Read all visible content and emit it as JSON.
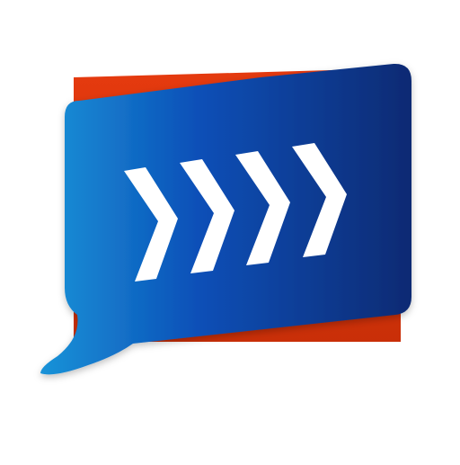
{
  "icon": {
    "name": "forward-chat-app-icon",
    "description_shapes": [
      "orange-card",
      "blue-speech-bubble",
      "chevron-arrows"
    ],
    "chevron_count": 4,
    "colors": {
      "background": "#ffffff",
      "card_orange": "#e53a0f",
      "card_orange_dark": "#c92f08",
      "bubble_light": "#1a93d8",
      "bubble_mid": "#0b50b8",
      "bubble_dark": "#0a2a73",
      "chevron": "#ffffff"
    }
  }
}
